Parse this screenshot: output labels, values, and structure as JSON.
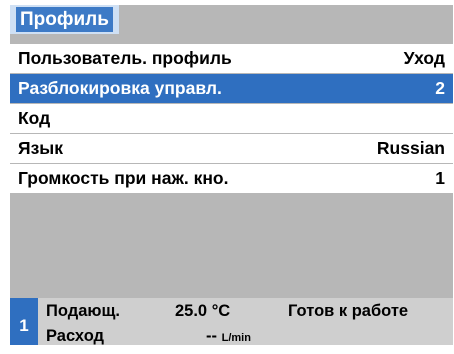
{
  "title": "Профиль",
  "menu": {
    "items": [
      {
        "label": "Пользователь. профиль",
        "value": "Уход"
      },
      {
        "label": "Разблокировка управл.",
        "value": "2"
      },
      {
        "label": "Код",
        "value": ""
      },
      {
        "label": "Язык",
        "value": "Russian"
      },
      {
        "label": "Громкость при наж. кно.",
        "value": "1"
      }
    ],
    "selected_index": 1
  },
  "status": {
    "number": "1",
    "line1_label": "Подающ.",
    "line1_value": "25.0 °C",
    "line2_label": "Расход",
    "line2_value": "--",
    "line2_unit": "L/min",
    "state": "Готов к работе"
  },
  "colors": {
    "accent": "#2f6fc0",
    "panel": "#b7b7b7",
    "title_bg": "#3d7ac6"
  }
}
